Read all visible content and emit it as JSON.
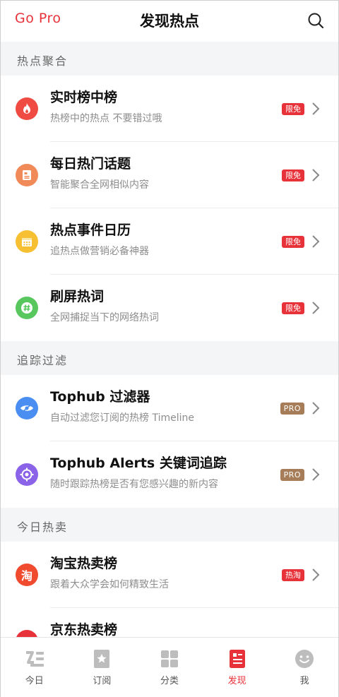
{
  "header": {
    "gopro": "Go Pro",
    "title": "发现热点"
  },
  "sections": [
    {
      "title": "热点聚合",
      "items": [
        {
          "title": "实时榜中榜",
          "subtitle": "热榜中的热点 不要错过哦",
          "badge": "限免",
          "color": "#ef4b43"
        },
        {
          "title": "每日热门话题",
          "subtitle": "智能聚合全网相似内容",
          "badge": "限免",
          "color": "#f08a58"
        },
        {
          "title": "热点事件日历",
          "subtitle": "追热点做营销必备神器",
          "badge": "限免",
          "color": "#f7c033"
        },
        {
          "title": "刷屏热词",
          "subtitle": "全网捕捉当下的网络热词",
          "badge": "限免",
          "color": "#58c75e"
        }
      ]
    },
    {
      "title": "追踪过滤",
      "items": [
        {
          "title": "Tophub 过滤器",
          "subtitle": "自动过滤您订阅的热榜 Timeline",
          "badge": "PRO",
          "color": "#4a8ef2"
        },
        {
          "title": "Tophub Alerts 关键词追踪",
          "subtitle": "随时跟踪热榜是否有您感兴趣的新内容",
          "badge": "PRO",
          "color": "#8b63e8"
        }
      ]
    },
    {
      "title": "今日热卖",
      "items": [
        {
          "title": "淘宝热卖榜",
          "subtitle": "跟着大众学会如何精致生活",
          "badge": "热淘",
          "color": "#f04a2f",
          "glyph": "淘"
        },
        {
          "title": "京东热卖榜",
          "subtitle": "",
          "badge": "",
          "color": "#e8323a"
        }
      ]
    }
  ],
  "tabs": [
    {
      "label": "今日",
      "active": false
    },
    {
      "label": "订阅",
      "active": false
    },
    {
      "label": "分类",
      "active": false
    },
    {
      "label": "发现",
      "active": true
    },
    {
      "label": "我",
      "active": false
    }
  ],
  "colors": {
    "accent": "#e8323a",
    "pro": "#a77c58"
  }
}
